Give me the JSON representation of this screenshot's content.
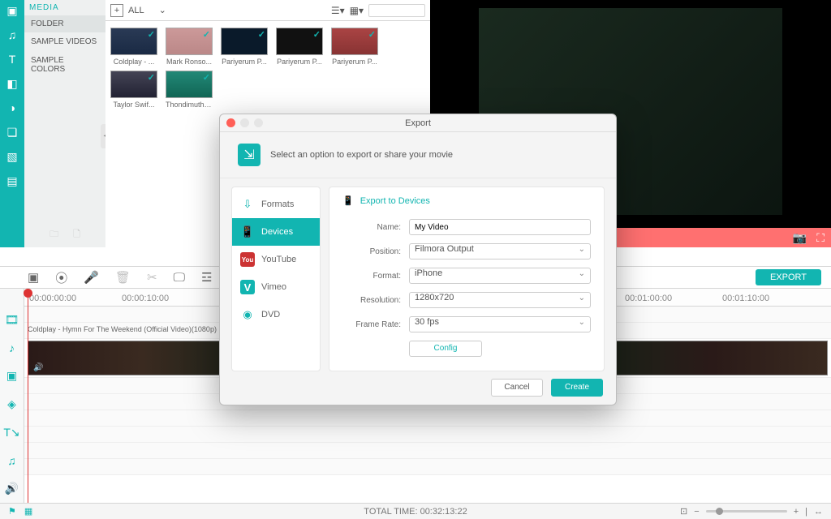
{
  "sidebar": {
    "header": "MEDIA",
    "folder": "FOLDER",
    "entries": [
      "SAMPLE VIDEOS",
      "SAMPLE COLORS"
    ]
  },
  "library": {
    "all": "ALL",
    "thumbs": [
      {
        "label": "Coldplay - ..."
      },
      {
        "label": "Mark Ronso..."
      },
      {
        "label": "Pariyerum P..."
      },
      {
        "label": "Pariyerum P..."
      },
      {
        "label": "Pariyerum P..."
      },
      {
        "label": "Taylor Swif..."
      },
      {
        "label": "Thondimutha..."
      }
    ]
  },
  "toolbar": {
    "export": "EXPORT"
  },
  "timeline": {
    "ticks": [
      "00:00:00:00",
      "00:00:10:00",
      "00:01:00:00",
      "00:01:10:00"
    ],
    "clip": "Coldplay - Hymn For The Weekend (Official Video)(1080p)"
  },
  "status": {
    "total": "TOTAL TIME: 00:32:13:22"
  },
  "dialog": {
    "title": "Export",
    "subtitle": "Select an option to export or share your movie",
    "tabs": {
      "formats": "Formats",
      "devices": "Devices",
      "youtube": "YouTube",
      "vimeo": "Vimeo",
      "dvd": "DVD"
    },
    "section": "Export to Devices",
    "labels": {
      "name": "Name:",
      "position": "Position:",
      "format": "Format:",
      "resolution": "Resolution:",
      "framerate": "Frame Rate:"
    },
    "values": {
      "name": "My Video",
      "position": "Filmora Output",
      "format": "iPhone",
      "resolution": "1280x720",
      "framerate": "30 fps"
    },
    "config": "Config",
    "cancel": "Cancel",
    "create": "Create"
  }
}
